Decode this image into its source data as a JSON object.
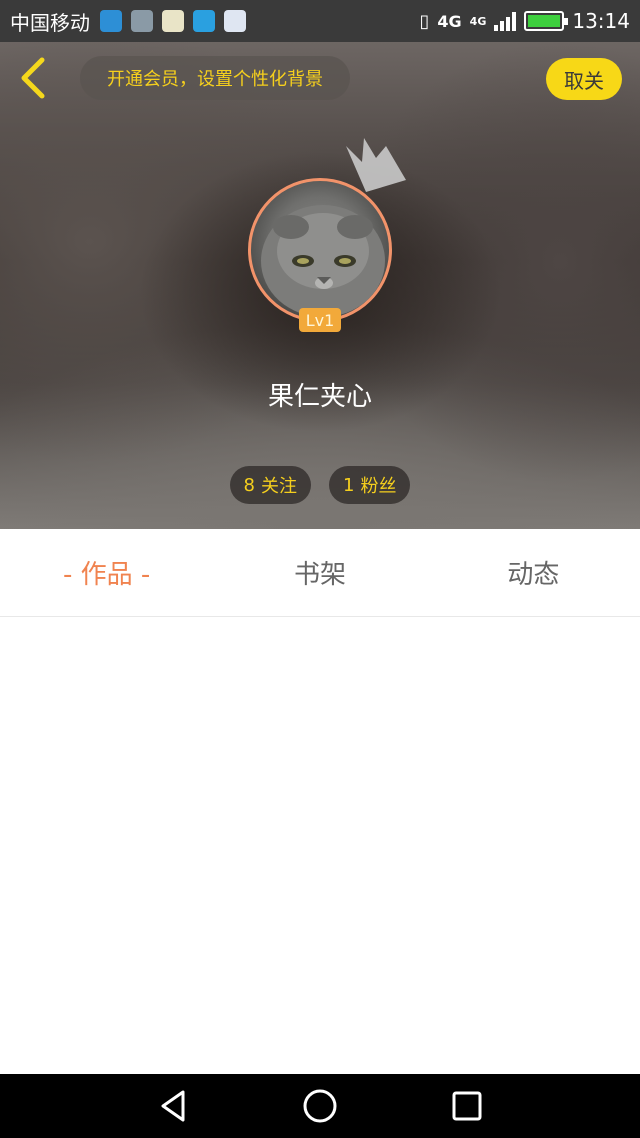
{
  "status_bar": {
    "carrier": "中国移动",
    "network": "4G",
    "network_small": "4G",
    "time": "13:14"
  },
  "header": {
    "vip_prompt": "开通会员，设置个性化背景",
    "unfollow_label": "取关",
    "level": "Lv1",
    "username": "果仁夹心",
    "following_count": "8",
    "following_label": "关注",
    "followers_count": "1",
    "followers_label": "粉丝"
  },
  "tabs": [
    {
      "label": "- 作品 -",
      "active": true
    },
    {
      "label": "书架",
      "active": false
    },
    {
      "label": "动态",
      "active": false
    }
  ],
  "colors": {
    "accent_yellow": "#f7d817",
    "accent_orange": "#f0834f",
    "level_badge": "#f2a93a",
    "avatar_border": "#f2936a"
  }
}
